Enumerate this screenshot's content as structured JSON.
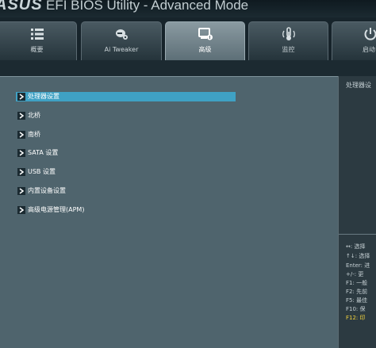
{
  "window": {
    "brand": "ASUS",
    "title": "EFI BIOS Utility - Advanced Mode"
  },
  "tabs": [
    {
      "label": "概要",
      "icon": "list-icon",
      "active": false
    },
    {
      "label": "Ai Tweaker",
      "icon": "tweaker-icon",
      "active": false
    },
    {
      "label": "高级",
      "icon": "advanced-icon",
      "active": true
    },
    {
      "label": "监控",
      "icon": "thermometer-icon",
      "active": false
    },
    {
      "label": "启动",
      "icon": "power-icon",
      "active": false
    }
  ],
  "menu": [
    {
      "label": "处理器设置",
      "selected": true
    },
    {
      "label": "北桥",
      "selected": false
    },
    {
      "label": "南桥",
      "selected": false
    },
    {
      "label": "SATA 设置",
      "selected": false
    },
    {
      "label": "USB 设置",
      "selected": false
    },
    {
      "label": "内置设备设置",
      "selected": false
    },
    {
      "label": "高级电源管理(APM)",
      "selected": false
    }
  ],
  "help": {
    "description": "处理器设",
    "keys": [
      {
        "text": "↔: 选择",
        "hot": false
      },
      {
        "text": "↑↓: 选择",
        "hot": false
      },
      {
        "text": "Enter: 进",
        "hot": false
      },
      {
        "text": "+/-: 更",
        "hot": false
      },
      {
        "text": "F1: 一般",
        "hot": false
      },
      {
        "text": "F2: 先前",
        "hot": false
      },
      {
        "text": "F5: 最佳",
        "hot": false
      },
      {
        "text": "F10: 保",
        "hot": false
      },
      {
        "text": "F12: 印",
        "hot": true
      }
    ]
  },
  "colors": {
    "selection": "#3fa1c4",
    "panel": "#4f646d",
    "hotkey": "#f2d23c"
  }
}
